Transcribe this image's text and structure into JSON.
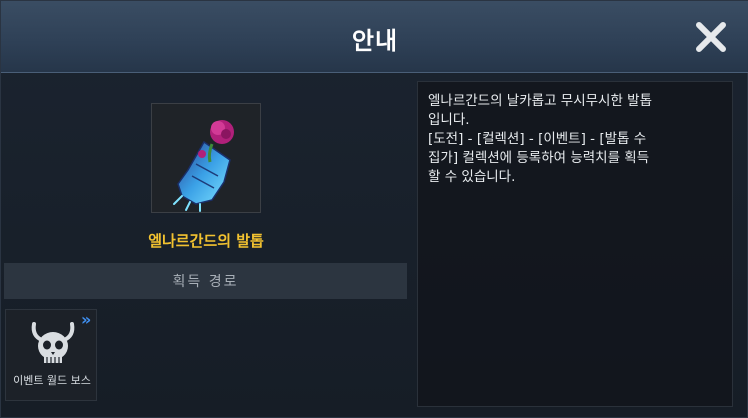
{
  "dialog": {
    "title": "안내",
    "close_icon": "close-icon"
  },
  "item": {
    "name": "엘나르간드의 발톱",
    "icon": "gauntlet-with-rose-icon"
  },
  "acquisition": {
    "header": "획득 경로",
    "sources": [
      {
        "label": "이벤트 월드 보스",
        "icon": "demon-skull-icon",
        "badge_icon": "double-chevron-right-icon"
      }
    ]
  },
  "description": {
    "text": "엘나르간드의 날카롭고 무시무시한 발톱\n입니다.\n[도전] - [컬렉션] - [이벤트] - [발톱 수\n집가] 컬렉션에 등록하여 능력치를 획득\n할 수 있습니다."
  },
  "colors": {
    "item_name": "#f2c230",
    "accent_arrow": "#3f8ff0",
    "title_bar": "#2f4157"
  }
}
